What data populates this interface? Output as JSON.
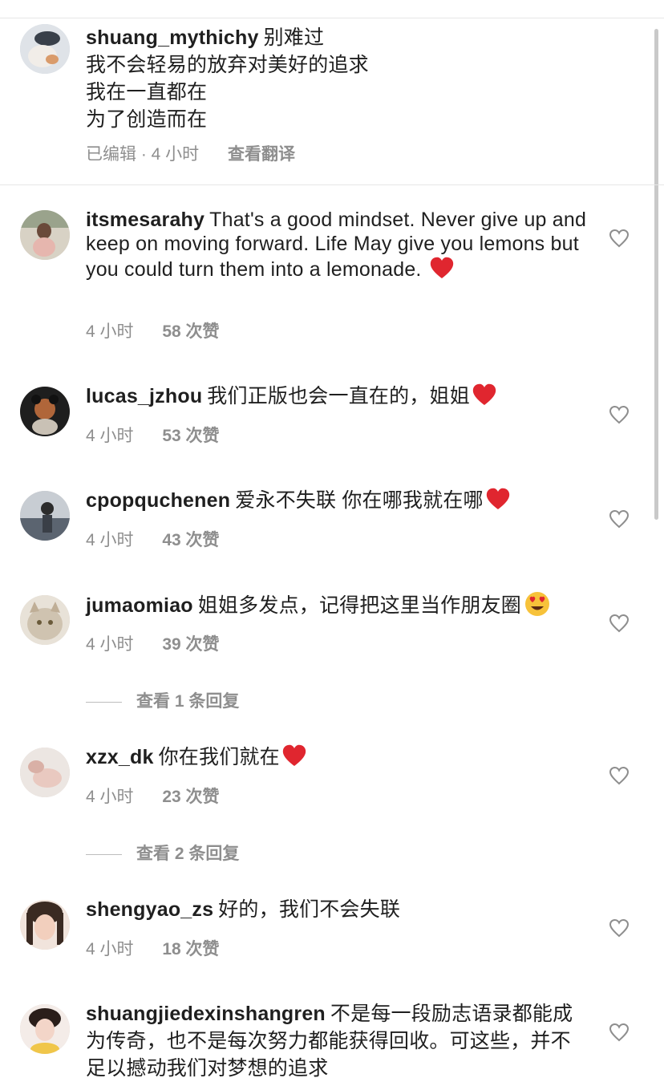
{
  "comments": [
    {
      "username": "shuang_mythichy",
      "lines": [
        "别难过",
        "我不会轻易的放弃对美好的追求",
        "我在一直都在",
        "为了创造而在"
      ],
      "edited": "已编辑 · 4 小时",
      "translate": "查看翻译"
    },
    {
      "username": "itsmesarahy",
      "text": "That's a good mindset. Never give up and keep on moving forward. Life  May give you lemons but you could turn them into a lemonade.",
      "time": "4 小时",
      "likes": "58 次赞",
      "emoji": "red-heart"
    },
    {
      "username": "lucas_jzhou",
      "text": "我们正版也会一直在的，姐姐",
      "time": "4 小时",
      "likes": "53 次赞",
      "emoji": "red-heart"
    },
    {
      "username": "cpopquchenen",
      "text": "爱永不失联 你在哪我就在哪",
      "time": "4 小时",
      "likes": "43 次赞",
      "emoji": "red-heart"
    },
    {
      "username": "jumaomiao",
      "text": "姐姐多发点，记得把这里当作朋友圈",
      "time": "4 小时",
      "likes": "39 次赞",
      "emoji": "heart-eyes",
      "replies": "查看 1 条回复"
    },
    {
      "username": "xzx_dk",
      "text": "你在我们就在",
      "time": "4 小时",
      "likes": "23 次赞",
      "emoji": "red-heart",
      "replies": "查看 2 条回复"
    },
    {
      "username": "shengyao_zs",
      "text": "好的，我们不会失联",
      "time": "4 小时",
      "likes": "18 次赞"
    },
    {
      "username": "shuangjiedexinshangren",
      "text": "不是每一段励志语录都能成为传奇，也不是每次努力都能获得回收。可这些，并不足以撼动我们对梦想的追求"
    }
  ],
  "colors": {
    "text": "#1f1f1f",
    "muted": "#8e8e8e",
    "heart": "#e0262f",
    "divider": "#e6e6e6"
  }
}
